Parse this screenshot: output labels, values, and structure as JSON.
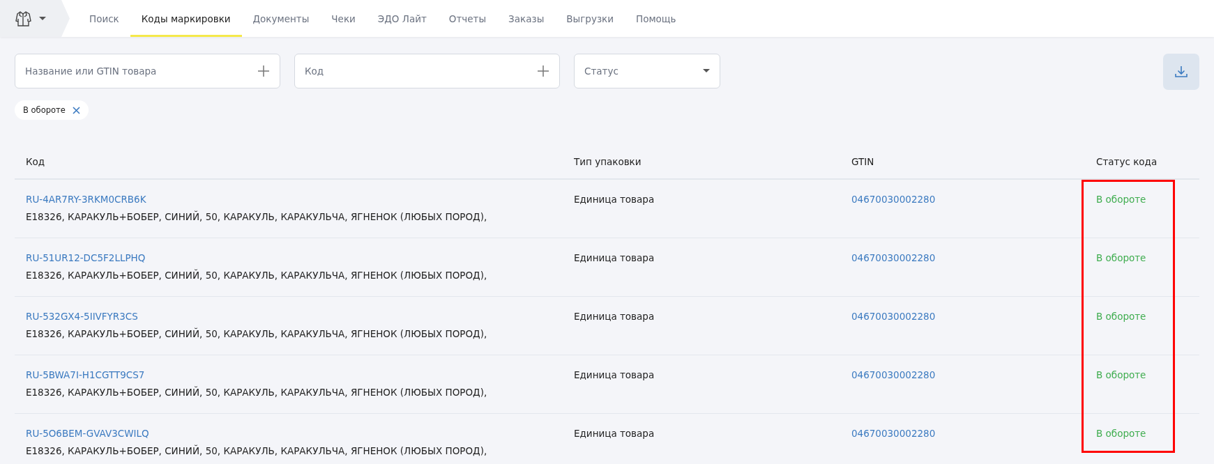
{
  "nav": {
    "tabs": [
      {
        "label": "Поиск",
        "selected": false
      },
      {
        "label": "Коды маркировки",
        "selected": true
      },
      {
        "label": "Документы",
        "selected": false
      },
      {
        "label": "Чеки",
        "selected": false
      },
      {
        "label": "ЭДО Лайт",
        "selected": false
      },
      {
        "label": "Отчеты",
        "selected": false
      },
      {
        "label": "Заказы",
        "selected": false
      },
      {
        "label": "Выгрузки",
        "selected": false
      },
      {
        "label": "Помощь",
        "selected": false
      }
    ]
  },
  "filters": [
    {
      "kind": "add",
      "placeholder": "Название или GTIN товара"
    },
    {
      "kind": "add",
      "placeholder": "Код"
    },
    {
      "kind": "select",
      "placeholder": "Статус"
    }
  ],
  "chips": [
    {
      "label": "В обороте"
    }
  ],
  "table": {
    "columns": [
      "Код",
      "Тип упаковки",
      "GTIN",
      "Статус кода"
    ],
    "rows": [
      {
        "code": "RU-4AR7RY-3RKM0CRB6K",
        "description": "E18326, КАРАКУЛЬ+БОБЕР, СИНИЙ, 50, КАРАКУЛЬ, КАРАКУЛЬЧА, ЯГНЕНОК (ЛЮБЫХ ПОРОД),",
        "package": "Единица товара",
        "gtin": "04670030002280",
        "status": "В обороте",
        "color": "#3fad4f"
      },
      {
        "code": "RU-51UR12-DC5F2LLPHQ",
        "description": "E18326, КАРАКУЛЬ+БОБЕР, СИНИЙ, 50, КАРАКУЛЬ, КАРАКУЛЬЧА, ЯГНЕНОК (ЛЮБЫХ ПОРОД),",
        "package": "Единица товара",
        "gtin": "04670030002280",
        "status": "В обороте",
        "color": "#3fad4f"
      },
      {
        "code": "RU-532GX4-5IIVFYR3CS",
        "description": "E18326, КАРАКУЛЬ+БОБЕР, СИНИЙ, 50, КАРАКУЛЬ, КАРАКУЛЬЧА, ЯГНЕНОК (ЛЮБЫХ ПОРОД),",
        "package": "Единица товара",
        "gtin": "04670030002280",
        "status": "В обороте",
        "color": "#3fad4f"
      },
      {
        "code": "RU-5BWA7I-H1CGTT9CS7",
        "description": "E18326, КАРАКУЛЬ+БОБЕР, СИНИЙ, 50, КАРАКУЛЬ, КАРАКУЛЬЧА, ЯГНЕНОК (ЛЮБЫХ ПОРОД),",
        "package": "Единица товара",
        "gtin": "04670030002280",
        "status": "В обороте",
        "color": "#3fad4f"
      },
      {
        "code": "RU-5O6BEM-GVAV3CWILQ",
        "description": "E18326, КАРАКУЛЬ+БОБЕР, СИНИЙ, 50, КАРАКУЛЬ, КАРАКУЛЬЧА, ЯГНЕНОК (ЛЮБЫХ ПОРОД),",
        "package": "Единица товара",
        "gtin": "04670030002280",
        "status": "В обороте",
        "color": "#3fad4f"
      }
    ]
  },
  "highlight": {
    "color": "#ff0000"
  }
}
